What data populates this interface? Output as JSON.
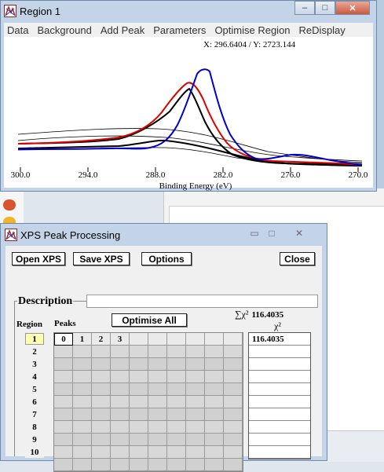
{
  "region_window": {
    "title": "Region 1",
    "menu": [
      "Data",
      "Background",
      "Add Peak",
      "Parameters",
      "Optimise Region",
      "ReDisplay"
    ],
    "caption_buttons": {
      "minimize": "–",
      "maximize": "□",
      "close": "✕"
    },
    "cursor_readout": "X: 296.6404 / Y: 2723.144",
    "plot": {
      "x_tick_labels": [
        "300.0",
        "294.0",
        "288.0",
        "282.0",
        "276.0",
        "270.0"
      ],
      "xlabel": "Binding Energy (eV)",
      "line_colors": {
        "data": "#0000cc",
        "envelope": "#dd0000",
        "component": "#000000"
      }
    }
  },
  "xps_window": {
    "title": "XPS Peak Processing",
    "caption_buttons": {
      "minimize": "▭",
      "maximize": "□",
      "close": "✕"
    },
    "buttons": {
      "open_xps": "Open XPS",
      "save_xps": "Save XPS",
      "options": "Options",
      "close": "Close",
      "optimise_all": "Optimise All"
    },
    "description_label": "Description",
    "description_value": "",
    "region_label": "Region",
    "peaks_label": "Peaks",
    "sum_chi_label": "∑χ²",
    "sum_chi_value": "116.4035",
    "chi_label": "χ²",
    "regions": [
      "1",
      "2",
      "3",
      "4",
      "5",
      "6",
      "7",
      "8",
      "9",
      "10"
    ],
    "peak_headers": [
      "0",
      "1",
      "2",
      "3",
      "",
      "",
      "",
      "",
      "",
      ""
    ],
    "chi_values": [
      "116.4035",
      "",
      "",
      "",
      "",
      "",
      "",
      "",
      "",
      ""
    ]
  }
}
